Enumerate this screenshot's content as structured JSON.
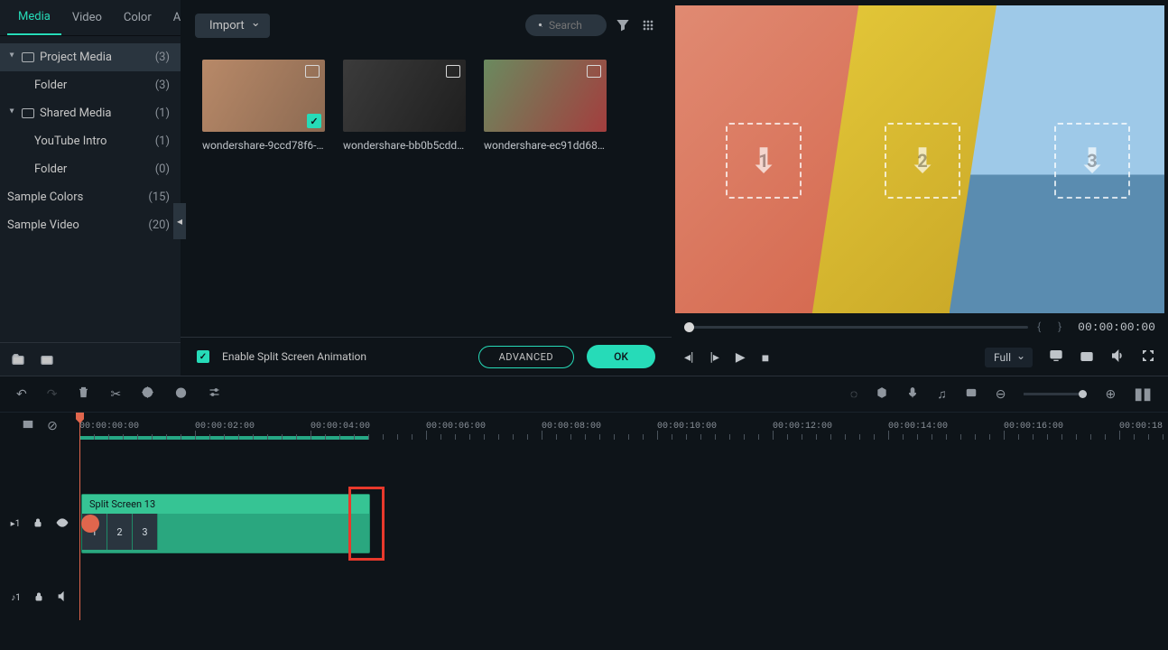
{
  "tabs": [
    "Media",
    "Video",
    "Color",
    "Animation"
  ],
  "activeTab": "Media",
  "tree": {
    "projectMedia": {
      "label": "Project Media",
      "count": "(3)"
    },
    "folder1": {
      "label": "Folder",
      "count": "(3)"
    },
    "sharedMedia": {
      "label": "Shared Media",
      "count": "(1)"
    },
    "youtubeIntro": {
      "label": "YouTube Intro",
      "count": "(1)"
    },
    "folder2": {
      "label": "Folder",
      "count": "(0)"
    },
    "sampleColors": {
      "label": "Sample Colors",
      "count": "(15)"
    },
    "sampleVideo": {
      "label": "Sample Video",
      "count": "(20)"
    }
  },
  "importLabel": "Import",
  "searchPlaceholder": "Search",
  "mediaItems": [
    {
      "name": "wondershare-9ccd78f6-6...",
      "checked": true
    },
    {
      "name": "wondershare-bb0b5cdd-...",
      "checked": false
    },
    {
      "name": "wondershare-ec91dd68-...",
      "checked": false
    }
  ],
  "splitScreen": {
    "checkbox": "Enable Split Screen Animation",
    "advanced": "ADVANCED",
    "ok": "OK"
  },
  "preview": {
    "quality": "Full",
    "timecode": "00:00:00:00"
  },
  "ruler": [
    "00:00:00:00",
    "00:00:02:00",
    "00:00:04:00",
    "00:00:06:00",
    "00:00:08:00",
    "00:00:10:00",
    "00:00:12:00",
    "00:00:14:00",
    "00:00:16:00",
    "00:00:18"
  ],
  "clip": {
    "title": "Split Screen 13",
    "segs": [
      "1",
      "2",
      "3"
    ]
  }
}
